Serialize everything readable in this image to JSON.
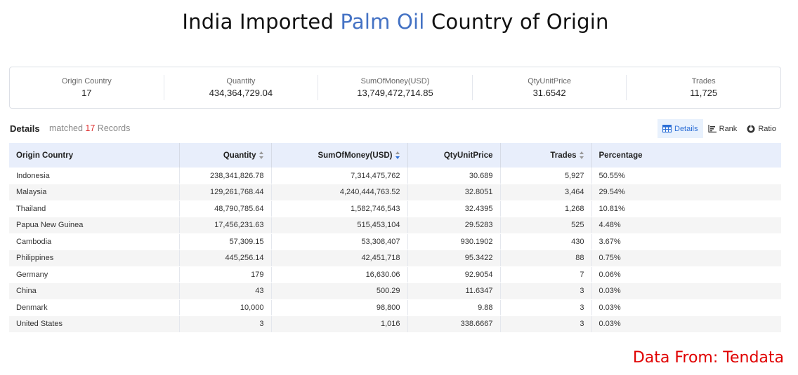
{
  "title": {
    "prefix": "India Imported ",
    "highlight": "Palm Oil",
    "suffix": " Country of Origin"
  },
  "summary": [
    {
      "label": "Origin Country",
      "value": "17"
    },
    {
      "label": "Quantity",
      "value": "434,364,729.04"
    },
    {
      "label": "SumOfMoney(USD)",
      "value": "13,749,472,714.85"
    },
    {
      "label": "QtyUnitPrice",
      "value": "31.6542"
    },
    {
      "label": "Trades",
      "value": "11,725"
    }
  ],
  "details": {
    "title": "Details",
    "matched_prefix": "matched ",
    "count": "17",
    "matched_suffix": " Records"
  },
  "view_toggle": {
    "details": "Details",
    "rank": "Rank",
    "ratio": "Ratio",
    "active": "details"
  },
  "table": {
    "columns": [
      "Origin Country",
      "Quantity",
      "SumOfMoney(USD)",
      "QtyUnitPrice",
      "Trades",
      "Percentage"
    ],
    "rows": [
      [
        "Indonesia",
        "238,341,826.78",
        "7,314,475,762",
        "30.689",
        "5,927",
        "50.55%"
      ],
      [
        "Malaysia",
        "129,261,768.44",
        "4,240,444,763.52",
        "32.8051",
        "3,464",
        "29.54%"
      ],
      [
        "Thailand",
        "48,790,785.64",
        "1,582,746,543",
        "32.4395",
        "1,268",
        "10.81%"
      ],
      [
        "Papua New Guinea",
        "17,456,231.63",
        "515,453,104",
        "29.5283",
        "525",
        "4.48%"
      ],
      [
        "Cambodia",
        "57,309.15",
        "53,308,407",
        "930.1902",
        "430",
        "3.67%"
      ],
      [
        "Philippines",
        "445,256.14",
        "42,451,718",
        "95.3422",
        "88",
        "0.75%"
      ],
      [
        "Germany",
        "179",
        "16,630.06",
        "92.9054",
        "7",
        "0.06%"
      ],
      [
        "China",
        "43",
        "500.29",
        "11.6347",
        "3",
        "0.03%"
      ],
      [
        "Denmark",
        "10,000",
        "98,800",
        "9.88",
        "3",
        "0.03%"
      ],
      [
        "United States",
        "3",
        "1,016",
        "338.6667",
        "3",
        "0.03%"
      ]
    ]
  },
  "source": "Data From: Tendata",
  "colors": {
    "accent": "#4472c4",
    "active_blue": "#2d6fd6",
    "source_red": "#e00000",
    "count_red": "#e03131",
    "header_bg": "#e8eefb"
  }
}
